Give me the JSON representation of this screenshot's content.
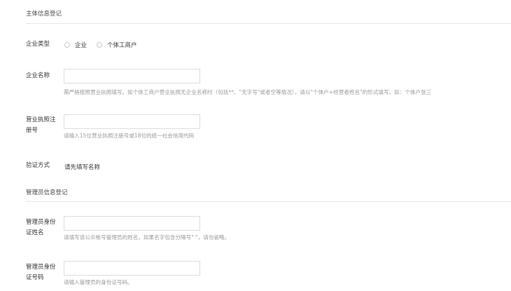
{
  "sections": {
    "subject": {
      "title": "主体信息登记"
    },
    "admin": {
      "title": "管理员信息登记"
    }
  },
  "subject": {
    "company_type": {
      "label": "企业类型",
      "options": [
        "企业",
        "个体工商户"
      ]
    },
    "company_name": {
      "label": "企业名称",
      "value": "",
      "hint": "需严格按照营业执照填写。如个体工商户营业执照无企业名称时（包括**、\"无字号\"或者空等情况），请以\"个体户+经营者姓名\"的形式填写。如：个体户张三"
    },
    "license_no": {
      "label_line1": "营业执照注",
      "label_line2": "册号",
      "value": "",
      "hint": "请输入15位营业执照注册号或18位的统一社会信用代码"
    },
    "verify": {
      "label": "验证方式",
      "value": "请先填写名称"
    }
  },
  "admin": {
    "name": {
      "label_line1": "管理员身份",
      "label_line2": "证姓名",
      "value": "",
      "hint": "请填写该公众帐号管理员的姓名，如果名字包含分隔号\"·\"，请勿省略。"
    },
    "id_no": {
      "label_line1": "管理员身份",
      "label_line2": "证号码",
      "value": "",
      "hint": "请输入管理员的身份证号码。"
    }
  }
}
